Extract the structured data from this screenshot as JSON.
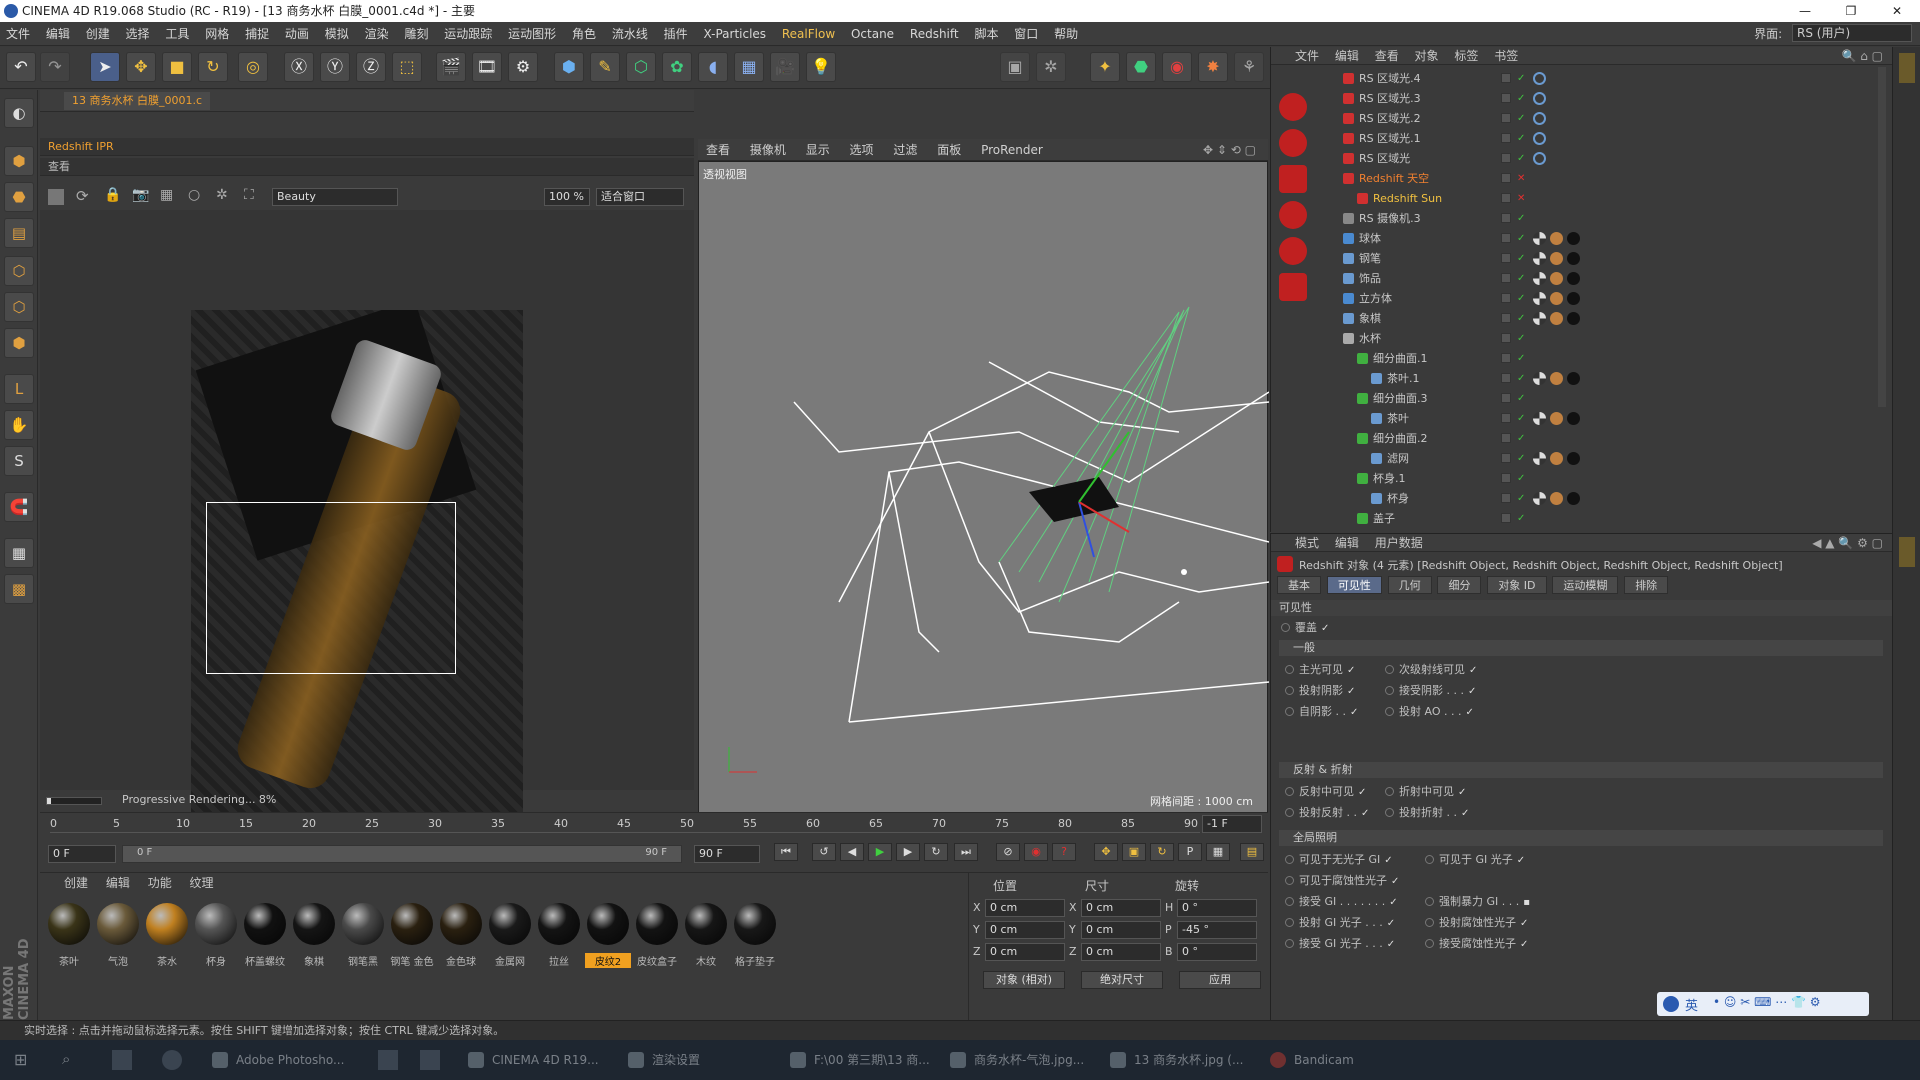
{
  "window": {
    "title": "CINEMA 4D R19.068 Studio (RC - R19) - [13 商务水杯 白膜_0001.c4d *] - 主要"
  },
  "menu": [
    "文件",
    "编辑",
    "创建",
    "选择",
    "工具",
    "网格",
    "捕捉",
    "动画",
    "模拟",
    "渲染",
    "雕刻",
    "运动跟踪",
    "运动图形",
    "角色",
    "流水线",
    "插件",
    "X-Particles",
    "RealFlow",
    "Octane",
    "Redshift",
    "脚本",
    "窗口",
    "帮助"
  ],
  "interface": {
    "label": "界面:",
    "value": "RS (用户)"
  },
  "ipr": {
    "tab": "13 商务水杯 白膜_0001.c",
    "title": "Redshift IPR",
    "view_menu": "查看",
    "beauty": "Beauty",
    "zoom": "100 %",
    "fit": "适合窗口",
    "progress_text": "Progressive Rendering... 8%",
    "progress": 0.08
  },
  "viewport": {
    "menus": [
      "查看",
      "摄像机",
      "显示",
      "选项",
      "过滤",
      "面板",
      "ProRender"
    ],
    "label": "透视视图",
    "grid": "网格间距 : 1000 cm"
  },
  "timeline": {
    "ticks": [
      "0",
      "5",
      "10",
      "15",
      "20",
      "25",
      "30",
      "35",
      "40",
      "45",
      "50",
      "55",
      "60",
      "65",
      "70",
      "75",
      "80",
      "85",
      "90"
    ],
    "end_field": "-1 F",
    "start": "0 F",
    "slider_start": "0 F",
    "slider_end": "90 F",
    "end": "90 F"
  },
  "materials": {
    "menus": [
      "创建",
      "编辑",
      "功能",
      "纹理"
    ],
    "items": [
      {
        "name": "茶叶",
        "color": "#3a3418"
      },
      {
        "name": "气泡",
        "color": "#6a5a3a"
      },
      {
        "name": "茶水",
        "color": "#c08020"
      },
      {
        "name": "杯身",
        "color": "#555555"
      },
      {
        "name": "杯盖螺纹",
        "color": "#111111"
      },
      {
        "name": "象棋",
        "color": "#151515"
      },
      {
        "name": "钢笔黑",
        "color": "#4a4a4a"
      },
      {
        "name": "钢笔 金色",
        "color": "#2a2010"
      },
      {
        "name": "金色球",
        "color": "#2a2010"
      },
      {
        "name": "金属网",
        "color": "#1a1a1a"
      },
      {
        "name": "拉丝",
        "color": "#141414"
      },
      {
        "name": "皮纹2",
        "color": "#121212"
      },
      {
        "name": "皮纹盒子",
        "color": "#131313"
      },
      {
        "name": "木纹",
        "color": "#161616"
      },
      {
        "name": "格子垫子",
        "color": "#181818"
      }
    ]
  },
  "coords": {
    "headers": [
      "位置",
      "尺寸",
      "旋转"
    ],
    "rows": [
      {
        "a": "X",
        "av": "0 cm",
        "b": "X",
        "bv": "0 cm",
        "c": "H",
        "cv": "0 °"
      },
      {
        "a": "Y",
        "av": "0 cm",
        "b": "Y",
        "bv": "0 cm",
        "c": "P",
        "cv": "-45 °"
      },
      {
        "a": "Z",
        "av": "0 cm",
        "b": "Z",
        "bv": "0 cm",
        "c": "B",
        "cv": "0 °"
      }
    ],
    "mode1": "对象 (相对)",
    "mode2": "绝对尺寸",
    "apply": "应用"
  },
  "objects": {
    "menus": [
      "文件",
      "编辑",
      "查看",
      "对象",
      "标签",
      "书签"
    ],
    "rows": [
      {
        "name": "RS 区域光.4",
        "indent": 0,
        "color": "#d03030"
      },
      {
        "name": "RS 区域光.3",
        "indent": 0,
        "color": "#d03030"
      },
      {
        "name": "RS 区域光.2",
        "indent": 0,
        "color": "#d03030"
      },
      {
        "name": "RS 区域光.1",
        "indent": 0,
        "color": "#d03030"
      },
      {
        "name": "RS 区域光",
        "indent": 0,
        "color": "#d03030"
      },
      {
        "name": "Redshift 天空",
        "indent": 0,
        "color": "#d03030",
        "hl": true
      },
      {
        "name": "Redshift Sun",
        "indent": 1,
        "color": "#d03030",
        "hl2": true
      },
      {
        "name": "RS 摄像机.3",
        "indent": 0,
        "color": "#888888"
      },
      {
        "name": "球体",
        "indent": 0,
        "color": "#4a8ad0"
      },
      {
        "name": "钢笔",
        "indent": 0,
        "color": "#6a9ad0"
      },
      {
        "name": "饰品",
        "indent": 0,
        "color": "#6a9ad0"
      },
      {
        "name": "立方体",
        "indent": 0,
        "color": "#4a8ad0"
      },
      {
        "name": "象棋",
        "indent": 0,
        "color": "#6a9ad0"
      },
      {
        "name": "水杯",
        "indent": 0,
        "color": "#aaaaaa"
      },
      {
        "name": "细分曲面.1",
        "indent": 1,
        "color": "#40b040"
      },
      {
        "name": "茶叶.1",
        "indent": 2,
        "color": "#6a9ad0"
      },
      {
        "name": "细分曲面.3",
        "indent": 1,
        "color": "#40b040"
      },
      {
        "name": "茶叶",
        "indent": 2,
        "color": "#6a9ad0"
      },
      {
        "name": "细分曲面.2",
        "indent": 1,
        "color": "#40b040"
      },
      {
        "name": "滤网",
        "indent": 2,
        "color": "#6a9ad0"
      },
      {
        "name": "杯身.1",
        "indent": 1,
        "color": "#40b040"
      },
      {
        "name": "杯身",
        "indent": 2,
        "color": "#6a9ad0"
      },
      {
        "name": "盖子",
        "indent": 1,
        "color": "#40b040"
      }
    ]
  },
  "attributes": {
    "menus": [
      "模式",
      "编辑",
      "用户数据"
    ],
    "title": "Redshift 对象 (4 元素) [Redshift Object, Redshift Object, Redshift Object, Redshift Object]",
    "tabs": [
      "基本",
      "可见性",
      "几何",
      "细分",
      "对象 ID",
      "运动模糊",
      "排除"
    ],
    "section_label": "可见性",
    "override": "覆盖",
    "sec_general": "一般",
    "general": [
      [
        "主光可见",
        "次级射线可见"
      ],
      [
        "投射阴影",
        "接受阴影 . . ."
      ],
      [
        "自阴影 . .",
        "投射 AO . . ."
      ]
    ],
    "sec_refl": "反射 & 折射",
    "refl": [
      [
        "反射中可见",
        "折射中可见"
      ],
      [
        "投射反射 . .",
        "投射折射 . ."
      ]
    ],
    "sec_gi": "全局照明",
    "gi": [
      [
        "可见于无光子 GI",
        "可见于 GI 光子"
      ],
      [
        "可见于腐蚀性光子",
        ""
      ],
      [
        "接受 GI . . . . . . .",
        "强制暴力 GI . . ."
      ],
      [
        "投射 GI 光子 . . .",
        "投射腐蚀性光子"
      ],
      [
        "接受 GI 光子 . . .",
        "接受腐蚀性光子"
      ]
    ]
  },
  "status": "实时选择 : 点击并拖动鼠标选择元素。按住 SHIFT 键增加选择对象；按住 CTRL 键减少选择对象。",
  "taskbar": [
    "Adobe Photosho...",
    "CINEMA 4D R19...",
    "渲染设置",
    "F:\\00 第三期\\13 商...",
    "商务水杯-气泡.jpg...",
    "13 商务水杯.jpg (...",
    "Bandicam"
  ],
  "ime": "英"
}
